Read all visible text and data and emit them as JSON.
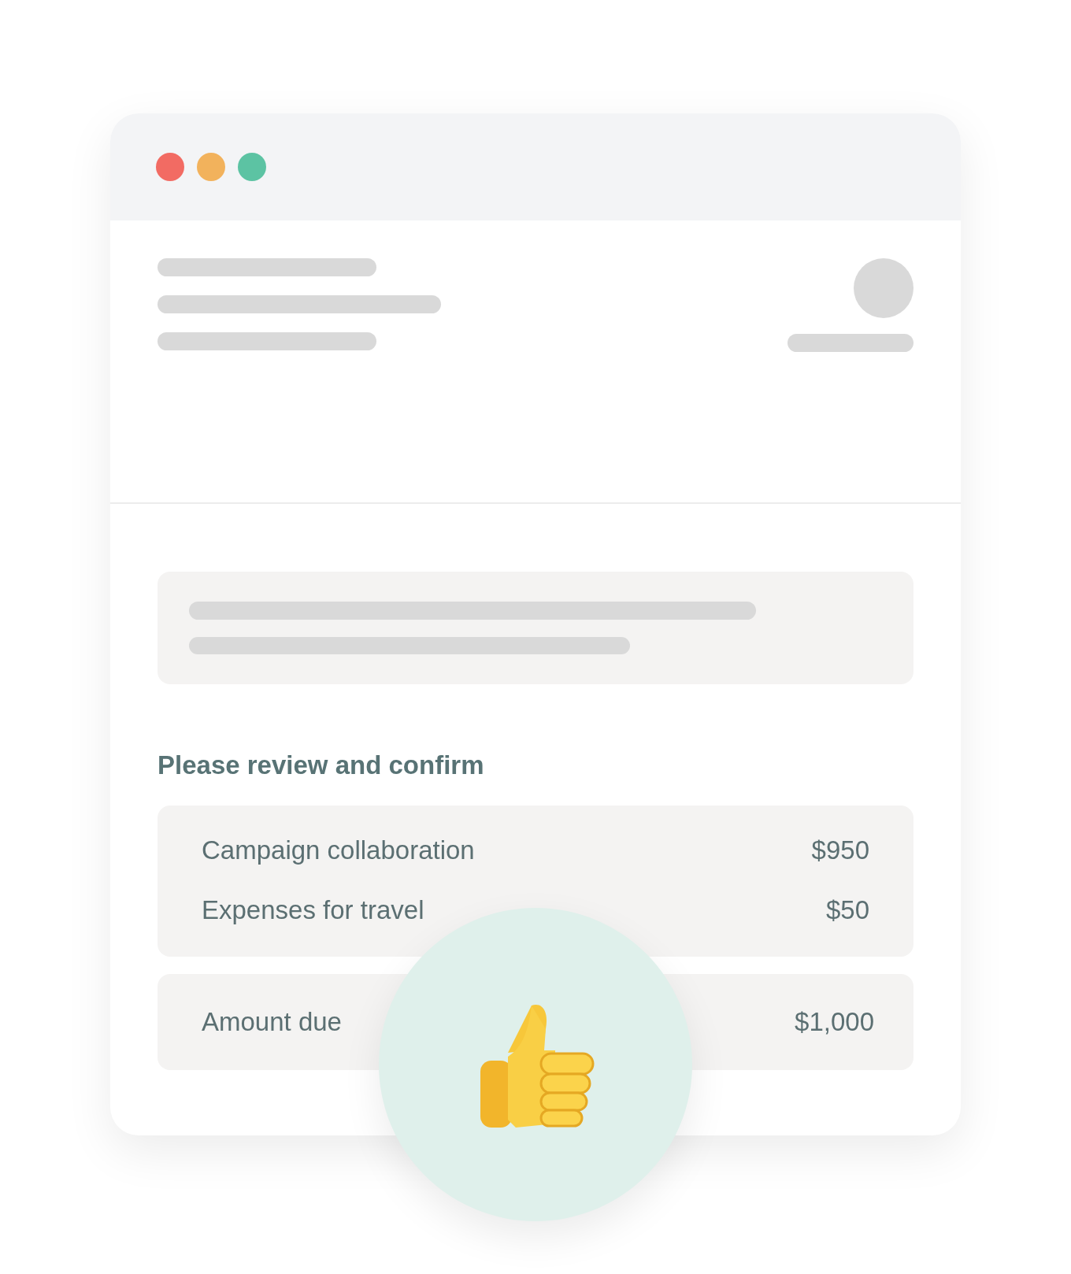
{
  "window": {
    "controls": [
      {
        "color": "#f26b63"
      },
      {
        "color": "#f2b25c"
      },
      {
        "color": "#5cc3a3"
      }
    ]
  },
  "heading": "Please review and confirm",
  "line_items": [
    {
      "label": "Campaign collaboration",
      "amount": "$950"
    },
    {
      "label": "Expenses for travel",
      "amount": "$50"
    }
  ],
  "total": {
    "label": "Amount due",
    "amount": "$1,000"
  }
}
